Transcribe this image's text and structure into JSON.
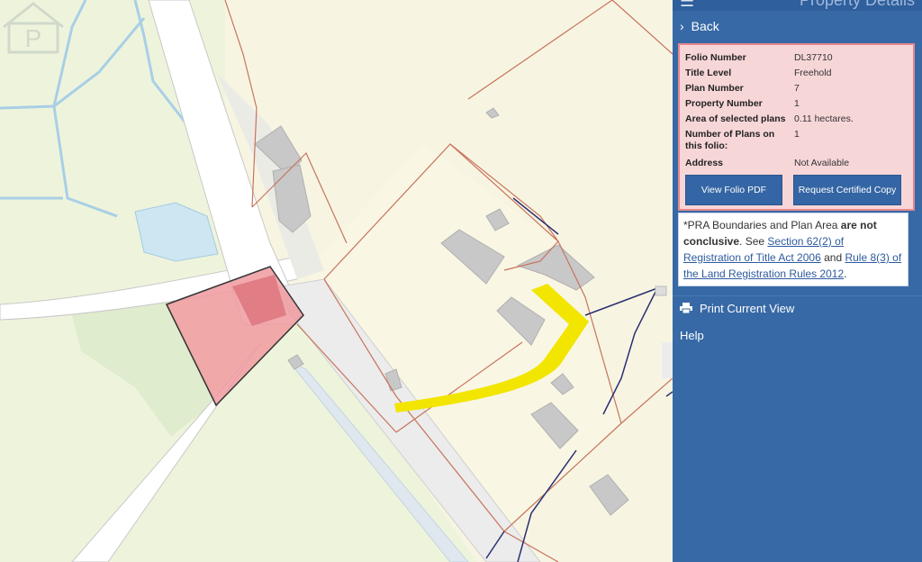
{
  "map": {
    "watermark_icon": "property-watermark-icon"
  },
  "panel": {
    "header_icon": "hamburger-menu-icon",
    "title": "Property Details",
    "back_label": "Back",
    "back_icon": "chevron-right-icon",
    "folio": {
      "rows": [
        {
          "key": "Folio Number",
          "value": "DL37710"
        },
        {
          "key": "Title Level",
          "value": "Freehold"
        },
        {
          "key": "Plan Number",
          "value": "7"
        },
        {
          "key": "Property Number",
          "value": "1"
        },
        {
          "key": "Area of selected plans",
          "value": "0.11 hectares."
        },
        {
          "key": "Number of Plans on this folio:",
          "value": "1"
        },
        {
          "key": "Address",
          "value": "Not Available"
        }
      ],
      "view_pdf_label": "View Folio PDF",
      "request_copy_label": "Request Certified Copy"
    },
    "note": {
      "prefix": "*PRA Boundaries and Plan Area ",
      "bold": "are not conclusive",
      "mid": ". See ",
      "link1": "Section 62(2) of Registration of Title Act 2006",
      "and": " and ",
      "link2": "Rule 8(3) of the Land Registration Rules 2012",
      "suffix": "."
    },
    "print_label": "Print Current View",
    "print_icon": "printer-icon",
    "help_label": "Help"
  },
  "colors": {
    "panel_bg": "#3769a6",
    "selection_yellow": "#f2e500",
    "parcel_red": "#e8737a",
    "boundary": "#c8735c"
  }
}
